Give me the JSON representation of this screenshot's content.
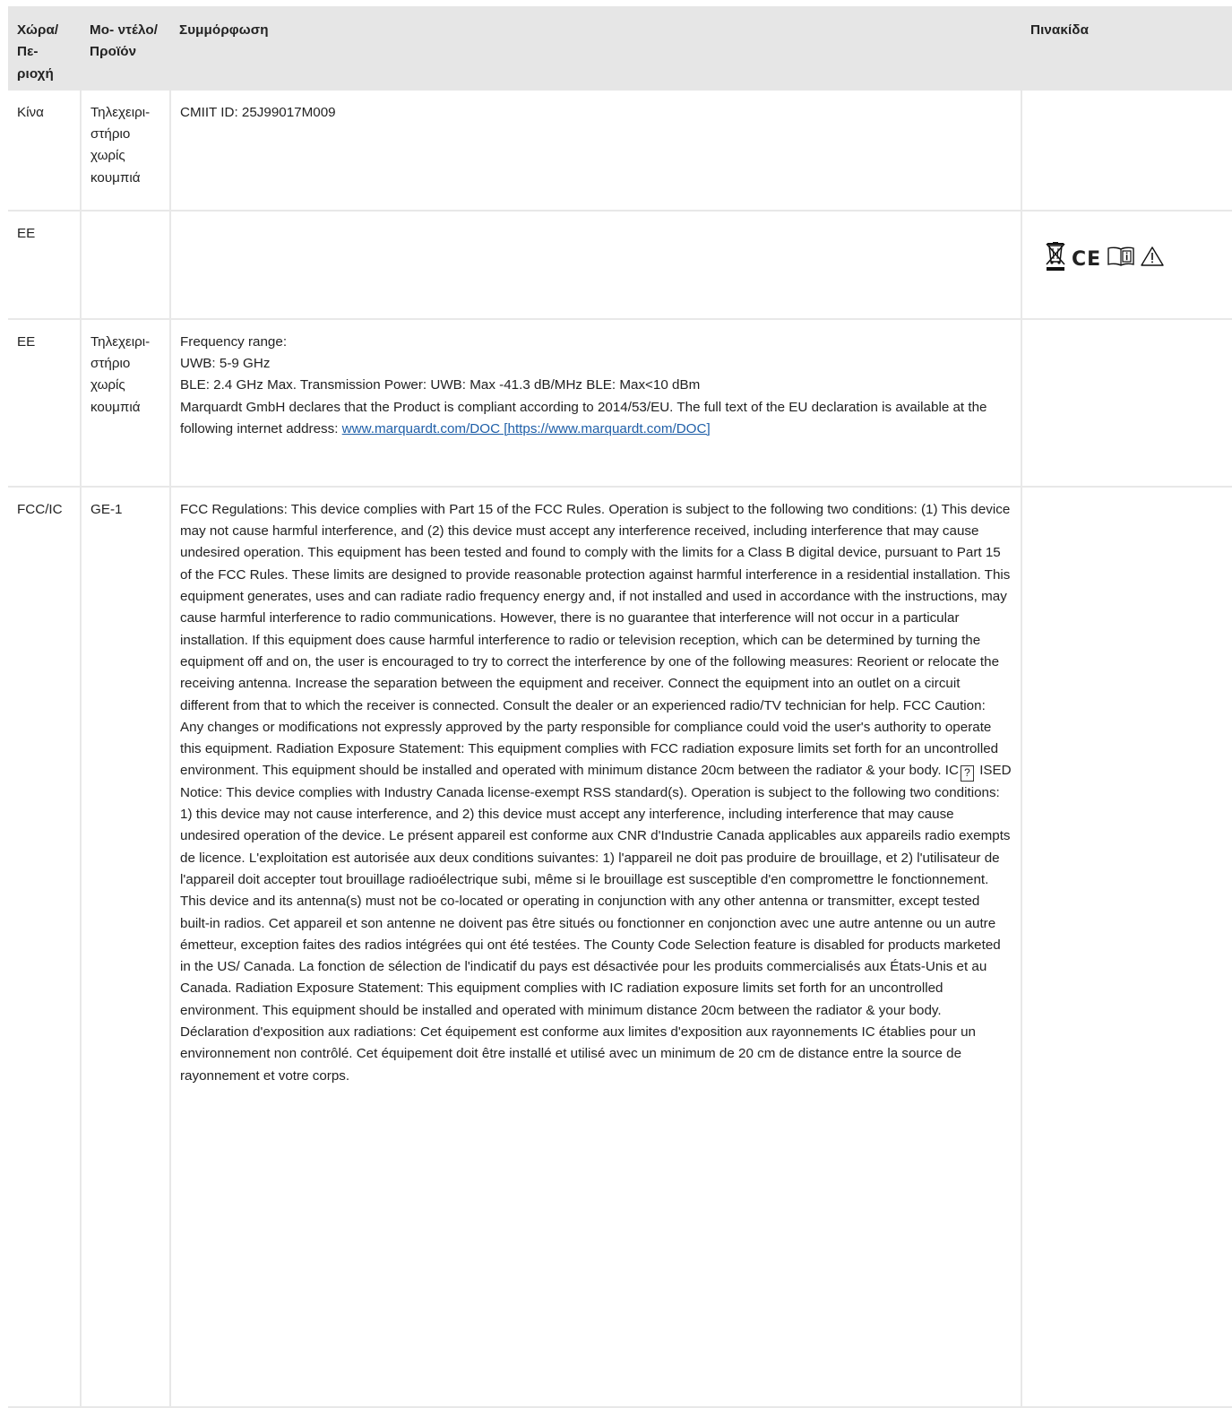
{
  "headers": {
    "region": "Χώρα/ Πε- ριοχή",
    "model": "Μο- ντέλο/ Προϊόν",
    "compliance": "Συμμόρφωση",
    "label": "Πινακίδα"
  },
  "rows": [
    {
      "region": "Κίνα",
      "model": "Τηλεχειρι- στήριο χωρίς κουμπιά",
      "compliance": "CMIIT ID: 25J99017M009"
    },
    {
      "region": "ΕΕ",
      "model": "",
      "compliance": ""
    },
    {
      "region": "ΕΕ",
      "model": "Τηλεχειρι- στήριο χωρίς κουμπιά",
      "lines": [
        "Frequency range:",
        "UWB: 5-9 GHz",
        "BLE: 2.4 GHz Max. Transmission Power: UWB: Max -41.3 dB/MHz BLE: Max<10 dBm",
        "Marquardt GmbH declares that the Product is compliant according to 2014/53/EU. The full text of the EU declaration is available at the following internet address: "
      ],
      "link_text": "www.marquardt.com/DOC [https://www.marquardt.com/DOC]"
    },
    {
      "region": "FCC/IC",
      "model": "GE-1",
      "compliance_a": "FCC Regulations: This device complies with Part 15 of the FCC Rules. Operation is subject to the following two conditions: (1) This device may not cause harmful interference, and (2) this device must accept any interference received, including interference that may cause undesired operation. This equipment has been tested and found to comply with the limits for a Class B digital device, pursuant to Part 15 of the FCC Rules. These limits are designed to provide reasonable protection against harmful interference in a residential installation. This equipment generates, uses and can radiate radio frequency energy and, if not installed and used in accordance with the instructions, may cause harmful interference to radio communications. However, there is no guarantee that interference will not occur in a particular installation. If this equipment does cause harmful interference to radio or television reception, which can be determined by turning the equipment off and on, the user is encouraged to try to correct the interference by one of the following measures: Reorient or relocate the receiving antenna. Increase the separation between the equipment and receiver. Connect the equipment into an outlet on a circuit different from that to which the receiver is connected. Consult the dealer or an experienced radio/TV technician for help. FCC Caution: Any changes or modifications not expressly approved by the party responsible for compliance could void the user's authority to operate this equipment. Radiation Exposure Statement: This equipment complies with FCC radiation exposure limits set forth for an uncontrolled environment. This equipment should be installed and operated with minimum distance 20cm between the radiator & your body. IC",
      "compliance_b": " ISED Notice: This device complies with Industry Canada license-exempt RSS standard(s). Operation is subject to the following two conditions: 1) this device may not cause interference, and 2) this device must accept any interference, including interference that may cause undesired operation of the device. Le présent appareil est conforme aux CNR d'Industrie Canada applicables aux appareils radio exempts de licence. L'exploitation est autorisée aux deux conditions suivantes: 1) l'appareil ne doit pas produire de brouillage, et 2) l'utilisateur de l'appareil doit accepter tout brouillage radioélectrique subi, même si le brouillage est susceptible d'en compromettre le fonctionnement. This device and its antenna(s) must not be co-located or operating in conjunction with any other antenna or transmitter, except tested built-in radios. Cet appareil et son antenne ne doivent pas être situés ou fonctionner en conjonction avec une autre antenne ou un autre émetteur, exception faites des radios intégrées qui ont été testées. The County Code Selection feature is disabled for products marketed in the US/ Canada. La fonction de sélection de l'indicatif du pays est désactivée pour les produits commercialisés aux États-Unis et au Canada. Radiation Exposure Statement: This equipment complies with IC radiation exposure limits set forth for an uncontrolled environment. This equipment should be installed and operated with minimum distance 20cm between the radiator & your body. Déclaration d'exposition aux radiations: Cet équipement est conforme aux limites d'exposition aux rayonnements IC établies pour un environnement non contrôlé. Cet équipement doit être installé et utilisé avec un minimum de 20 cm de distance entre la source de rayonnement et votre corps.",
      "unknown_glyph": "?"
    }
  ],
  "icons": [
    "weee-bin-icon",
    "ce-mark-icon",
    "manual-info-icon",
    "warning-triangle-icon"
  ],
  "ce_mark": "CE",
  "colors": {
    "header_bg": "#e6e6e6",
    "grid": "#e8e8e8",
    "link": "#1f5fa8"
  }
}
